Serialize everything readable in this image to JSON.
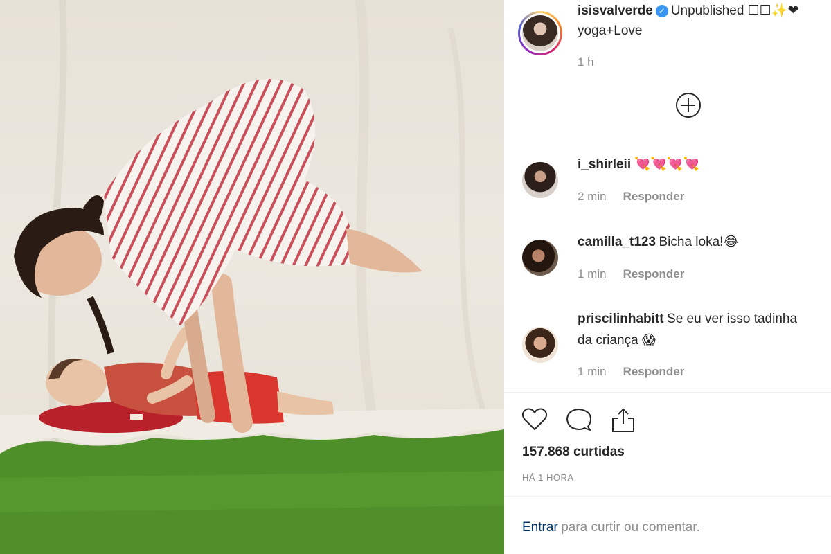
{
  "post": {
    "username": "isisvalverde",
    "verified_icon": "verified-check-icon",
    "caption_line1": "Unpublished ☐☐✨❤",
    "caption_line2": "yoga+Love",
    "time": "1 h",
    "load_more_icon": "plus-circle-icon"
  },
  "comments": [
    {
      "username": "i_shirleii",
      "text": "💘💘💘💘",
      "time": "2 min",
      "reply": "Responder"
    },
    {
      "username": "camilla_t123",
      "text": "Bicha loka!😂",
      "time": "1 min",
      "reply": "Responder"
    },
    {
      "username": "priscilinhabitt",
      "text": "Se eu ver isso tadinha",
      "text_line2": "da criança 😱",
      "time": "1 min",
      "reply": "Responder"
    }
  ],
  "actions": {
    "like_icon": "heart-icon",
    "comment_icon": "comment-icon",
    "share_icon": "share-icon"
  },
  "likes_text": "157.868 curtidas",
  "posted_ago": "HÁ 1 HORA",
  "login": {
    "link": "Entrar",
    "rest": "para curtir ou comentar."
  },
  "colors": {
    "link": "#003569",
    "meta": "#8e8e8e",
    "verified": "#3897f0"
  }
}
